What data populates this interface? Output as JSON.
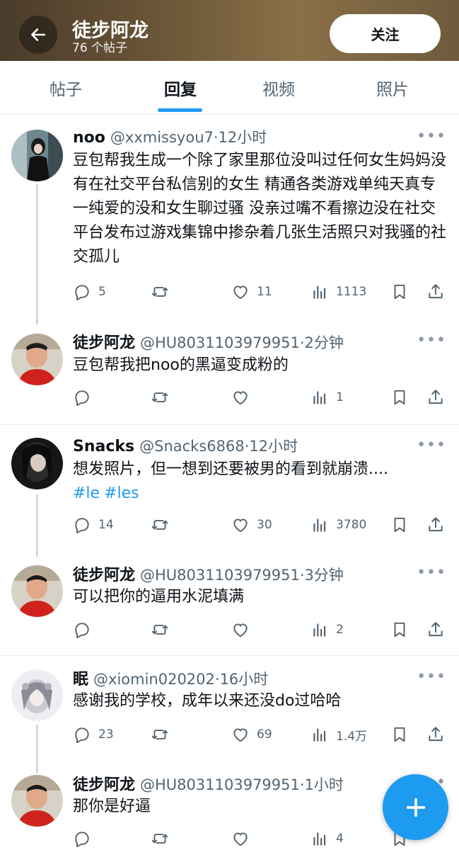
{
  "header": {
    "name": "徒步阿龙",
    "post_count": "76 个帖子",
    "follow_label": "关注",
    "back_icon": "arrow-left-icon"
  },
  "tabs": [
    {
      "label": "帖子",
      "active": false
    },
    {
      "label": "回复",
      "active": true
    },
    {
      "label": "视频",
      "active": false
    },
    {
      "label": "照片",
      "active": false
    }
  ],
  "tweets": [
    {
      "name": "noo",
      "handle": "@xxmissyou7·12小时",
      "text": "豆包帮我生成一个除了家里那位没叫过任何女生妈妈没有在社交平台私信别的女生 精通各类游戏单纯天真专一纯爱的没和女生聊过骚 没亲过嘴不看擦边没在社交 平台发布过游戏集锦中掺杂着几张生活照只对我骚的社交孤儿",
      "replies": "5",
      "retweets": "",
      "likes": "11",
      "views": "1113"
    },
    {
      "name": "徒步阿龙",
      "handle": "@HU8031103979951·2分钟",
      "text": "豆包帮我把noo的黑逼变成粉的",
      "replies": "",
      "retweets": "",
      "likes": "",
      "views": "1"
    },
    {
      "name": "Snacks",
      "handle": "@Snacks6868·12小时",
      "text": "想发照片，但一想到还要被男的看到就崩溃....",
      "hashtags": [
        "#le",
        "#les"
      ],
      "replies": "14",
      "retweets": "",
      "likes": "30",
      "views": "3780"
    },
    {
      "name": "徒步阿龙",
      "handle": "@HU8031103979951·3分钟",
      "text": "可以把你的逼用水泥填满",
      "replies": "",
      "retweets": "",
      "likes": "",
      "views": "2"
    },
    {
      "name": "眠",
      "handle": "@xiomin020202·16小时",
      "text": "感谢我的学校，成年以来还没do过哈哈",
      "replies": "23",
      "retweets": "",
      "likes": "69",
      "views": "1.4万"
    },
    {
      "name": "徒步阿龙",
      "handle": "@HU8031103979951·1小时",
      "text": "那你是好逼",
      "replies": "",
      "retweets": "",
      "likes": "",
      "views": "4"
    }
  ],
  "more_label": "•••",
  "fab_icon": "plus-icon",
  "colors": {
    "accent": "#1d9bf0",
    "text": "#0f1419",
    "muted": "#536471",
    "divider": "#e6ecf0"
  }
}
